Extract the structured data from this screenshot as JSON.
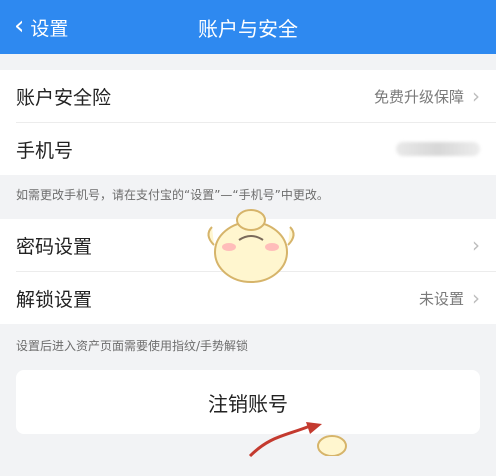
{
  "header": {
    "back_label": "设置",
    "title": "账户与安全"
  },
  "section1": {
    "items": [
      {
        "label": "账户安全险",
        "value": "免费升级保障"
      },
      {
        "label": "手机号",
        "value": ""
      }
    ],
    "note": "如需更改手机号，请在支付宝的“设置”—“手机号”中更改。"
  },
  "section2": {
    "items": [
      {
        "label": "密码设置",
        "value": ""
      },
      {
        "label": "解锁设置",
        "value": "未设置"
      }
    ],
    "note": "设置后进入资产页面需要使用指纹/手势解锁"
  },
  "logout": {
    "label": "注销账号"
  },
  "colors": {
    "header_bg": "#2e89f0",
    "page_bg": "#f2f3f5",
    "arrow": "#c43a2f"
  },
  "icons": {
    "back": "chevron-left-icon",
    "row_arrow": "chevron-right-icon",
    "mascot": "duck-mascot-icon"
  }
}
